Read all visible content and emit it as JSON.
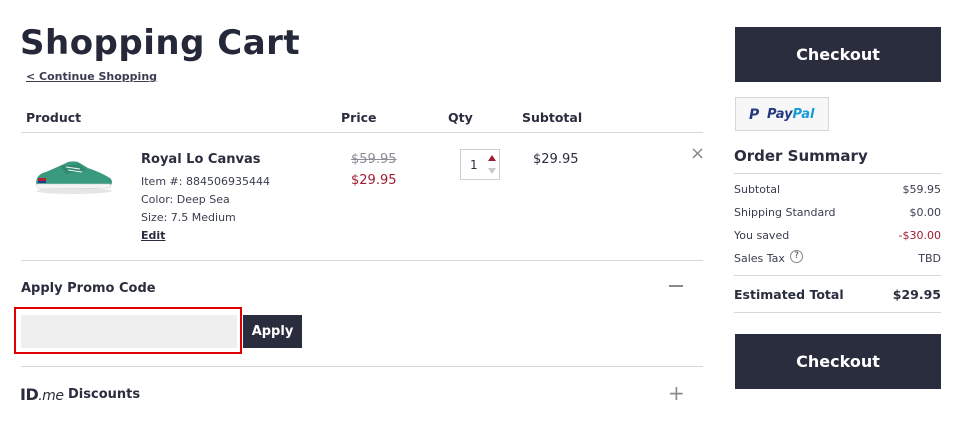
{
  "page": {
    "title": "Shopping Cart",
    "continue_link": "< Continue Shopping"
  },
  "table": {
    "headers": {
      "product": "Product",
      "price": "Price",
      "qty": "Qty",
      "subtotal": "Subtotal"
    },
    "items": [
      {
        "name": "Royal Lo Canvas",
        "item_number": "Item #: 884506935444",
        "color": "Color: Deep Sea",
        "size": "Size: 7.5 Medium",
        "edit_label": "Edit",
        "original_price": "$59.95",
        "sale_price": "$29.95",
        "quantity": "1",
        "subtotal": "$29.95",
        "remove_label": "×"
      }
    ]
  },
  "promo": {
    "label": "Apply Promo Code",
    "input_value": "",
    "input_placeholder": "",
    "apply_label": "Apply",
    "collapse_symbol": "minus"
  },
  "idme": {
    "logo_id": "ID",
    "logo_me": ".me",
    "label": "Discounts",
    "expand_label": "+"
  },
  "checkout": {
    "top_label": "Checkout",
    "bottom_label": "Checkout"
  },
  "paypal": {
    "mark": "P",
    "text_pay": "Pay",
    "text_pal": "Pal"
  },
  "order_summary": {
    "title": "Order Summary",
    "rows": [
      {
        "label": "Subtotal",
        "value": "$59.95"
      },
      {
        "label": "Shipping Standard",
        "value": "$0.00"
      },
      {
        "label": "You saved",
        "value": "-$30.00"
      },
      {
        "label": "Sales Tax",
        "value": "TBD"
      }
    ],
    "tax_help": "?",
    "estimated_total_label": "Estimated Total",
    "estimated_total_value": "$29.95"
  },
  "colors": {
    "primary": "#2a2d3e",
    "sale_red": "#9e1b32",
    "highlight_red": "#e00000",
    "shoe_green": "#3a9a7f"
  }
}
